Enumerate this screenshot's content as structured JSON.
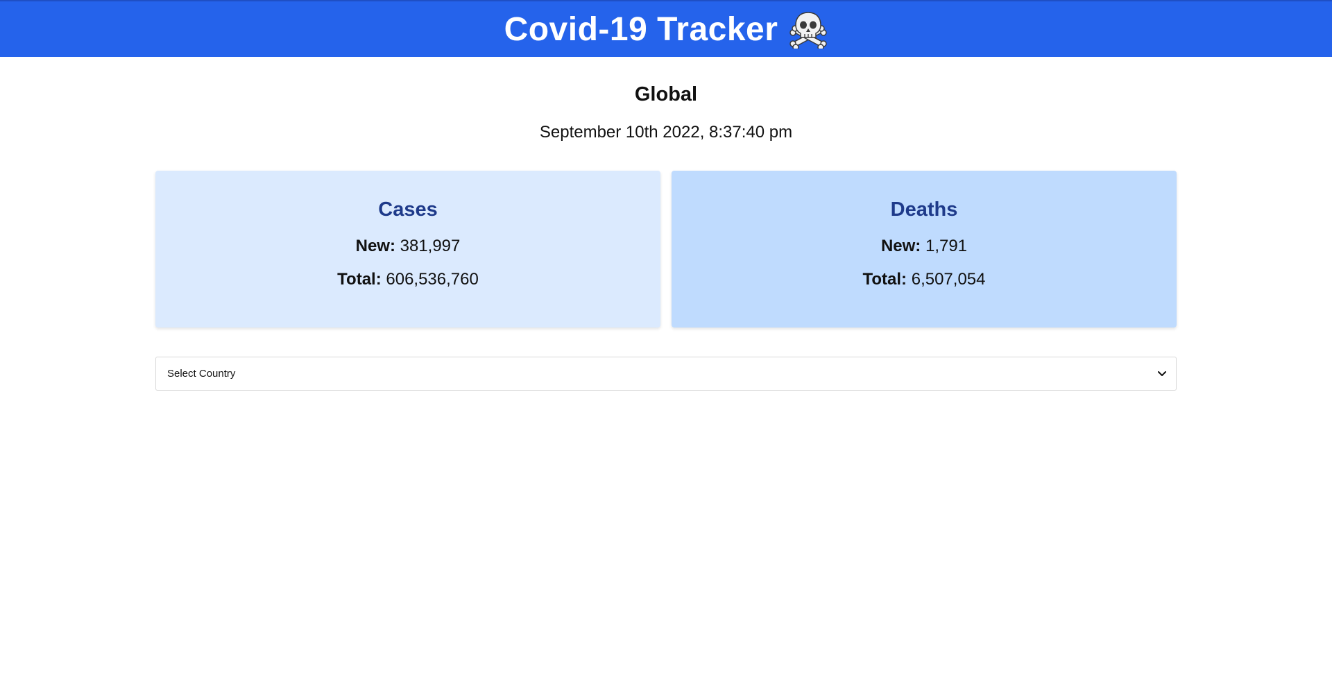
{
  "header": {
    "title": "Covid-19 Tracker",
    "icon": "skull-and-crossbones-icon",
    "color": "#2563eb"
  },
  "summary": {
    "region": "Global",
    "timestamp": "September 10th 2022, 8:37:40 pm"
  },
  "cards": {
    "cases": {
      "title": "Cases",
      "new_label": "New:",
      "new_value": "381,997",
      "total_label": "Total:",
      "total_value": "606,536,760",
      "background": "#dbeafe"
    },
    "deaths": {
      "title": "Deaths",
      "new_label": "New:",
      "new_value": "1,791",
      "total_label": "Total:",
      "total_value": "6,507,054",
      "background": "#bfdbfe"
    }
  },
  "country_select": {
    "selected": "Select Country",
    "icon": "chevron-down-icon"
  }
}
